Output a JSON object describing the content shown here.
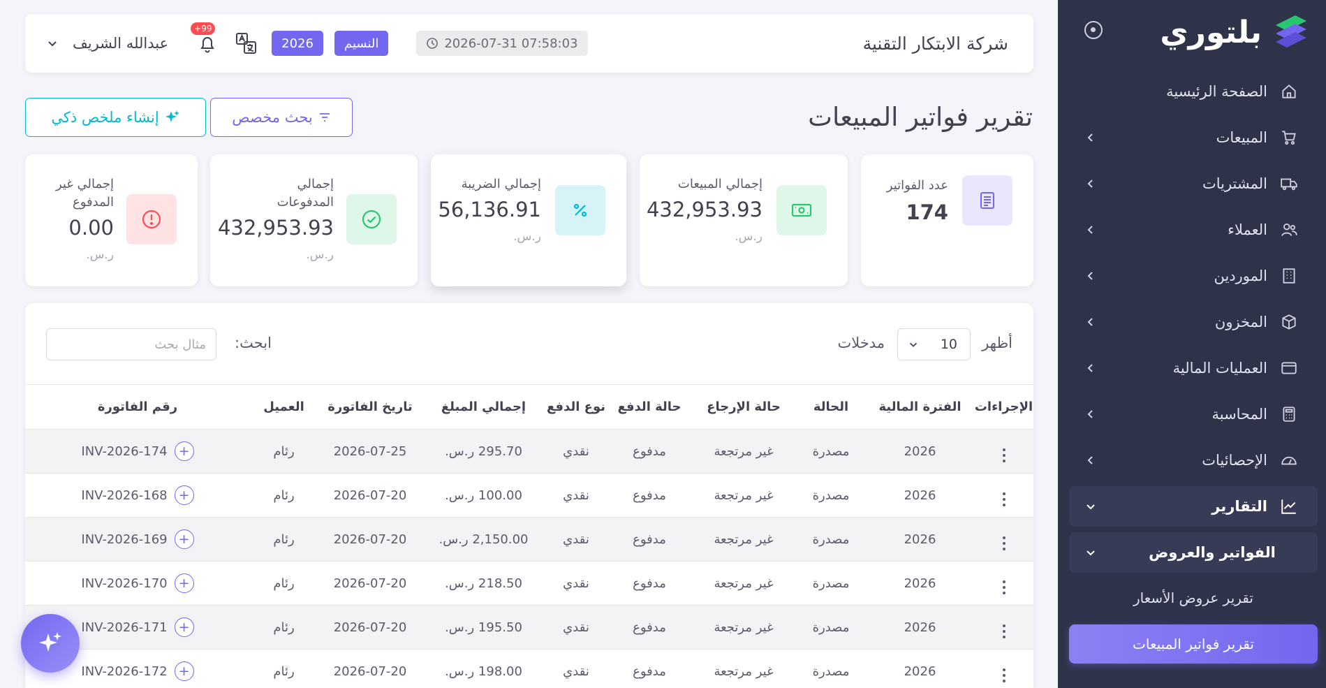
{
  "app": {
    "logo_text": "بلتوري",
    "brand_color": "#7367f0"
  },
  "sidebar": {
    "items": [
      {
        "label": "الصفحة الرئيسية",
        "icon": "home-icon"
      },
      {
        "label": "المبيعات",
        "icon": "cart-icon"
      },
      {
        "label": "المشتريات",
        "icon": "truck-icon"
      },
      {
        "label": "العملاء",
        "icon": "users-icon"
      },
      {
        "label": "الموردين",
        "icon": "building-icon"
      },
      {
        "label": "المخزون",
        "icon": "box-icon"
      },
      {
        "label": "العمليات المالية",
        "icon": "wallet-icon"
      },
      {
        "label": "المحاسبة",
        "icon": "calculator-icon"
      },
      {
        "label": "الإحصائيات",
        "icon": "gauge-icon"
      },
      {
        "label": "التقارير",
        "icon": "chart-line-icon"
      }
    ],
    "subgroup": {
      "label": "الفواتير والعروض"
    },
    "subitems": [
      {
        "label": "تقرير عروض الأسعار"
      },
      {
        "label": "تقرير فواتير المبيعات"
      }
    ]
  },
  "topbar": {
    "company": "شركة الابتكار التقنية",
    "datetime": "2026-07-31 07:58:03",
    "branch": "النسيم",
    "year": "2026",
    "notifications": "+99",
    "user_name": "عبدالله الشريف"
  },
  "page": {
    "title": "تقرير فواتير المبيعات",
    "filter_button": "بحث مخصص",
    "ai_button": "إنشاء ملخص ذكي"
  },
  "stats": {
    "invoices_count": {
      "label": "عدد الفواتير",
      "value": "174"
    },
    "total_sales": {
      "label": "إجمالي المبيعات",
      "value": "432,953.93",
      "currency": "ر.س."
    },
    "total_tax": {
      "label": "إجمالي الضريبة",
      "value": "56,136.91",
      "currency": "ر.س."
    },
    "total_paid": {
      "label_line1": "إجمالي",
      "label_line2": "المدفوعات",
      "value": "432,953.93",
      "currency": "ر.س."
    },
    "total_unpaid": {
      "label_line1": "إجمالي غير",
      "label_line2": "المدفوع",
      "value": "0.00",
      "currency": "ر.س."
    }
  },
  "table": {
    "show_label": "أظهر",
    "page_size": "10",
    "entries_label": "مدخلات",
    "search_label": "ابحث:",
    "search_placeholder": "مثال بحث",
    "columns": [
      "رقم الفاتورة",
      "العميل",
      "تاريخ الفاتورة",
      "إجمالي المبلغ",
      "نوع الدفع",
      "حالة الدفع",
      "حالة الإرجاع",
      "الحالة",
      "الفترة المالية",
      "الإجراءات"
    ],
    "rows": [
      {
        "invoice": "INV-2026-174",
        "customer": "رئام",
        "date": "2026-07-25",
        "amount": "295.70 ر.س.",
        "payment_type": "نقدي",
        "payment_status": "مدفوع",
        "return_status": "غير مرتجعة",
        "status": "مصدرة",
        "period": "2026"
      },
      {
        "invoice": "INV-2026-168",
        "customer": "رئام",
        "date": "2026-07-20",
        "amount": "100.00 ر.س.",
        "payment_type": "نقدي",
        "payment_status": "مدفوع",
        "return_status": "غير مرتجعة",
        "status": "مصدرة",
        "period": "2026"
      },
      {
        "invoice": "INV-2026-169",
        "customer": "رئام",
        "date": "2026-07-20",
        "amount": "2,150.00 ر.س.",
        "payment_type": "نقدي",
        "payment_status": "مدفوع",
        "return_status": "غير مرتجعة",
        "status": "مصدرة",
        "period": "2026"
      },
      {
        "invoice": "INV-2026-170",
        "customer": "رئام",
        "date": "2026-07-20",
        "amount": "218.50 ر.س.",
        "payment_type": "نقدي",
        "payment_status": "مدفوع",
        "return_status": "غير مرتجعة",
        "status": "مصدرة",
        "period": "2026"
      },
      {
        "invoice": "INV-2026-171",
        "customer": "رئام",
        "date": "2026-07-20",
        "amount": "195.50 ر.س.",
        "payment_type": "نقدي",
        "payment_status": "مدفوع",
        "return_status": "غير مرتجعة",
        "status": "مصدرة",
        "period": "2026"
      },
      {
        "invoice": "INV-2026-172",
        "customer": "رئام",
        "date": "2026-07-20",
        "amount": "198.00 ر.س.",
        "payment_type": "نقدي",
        "payment_status": "مدفوع",
        "return_status": "غير مرتجعة",
        "status": "مصدرة",
        "period": "2026"
      }
    ]
  }
}
